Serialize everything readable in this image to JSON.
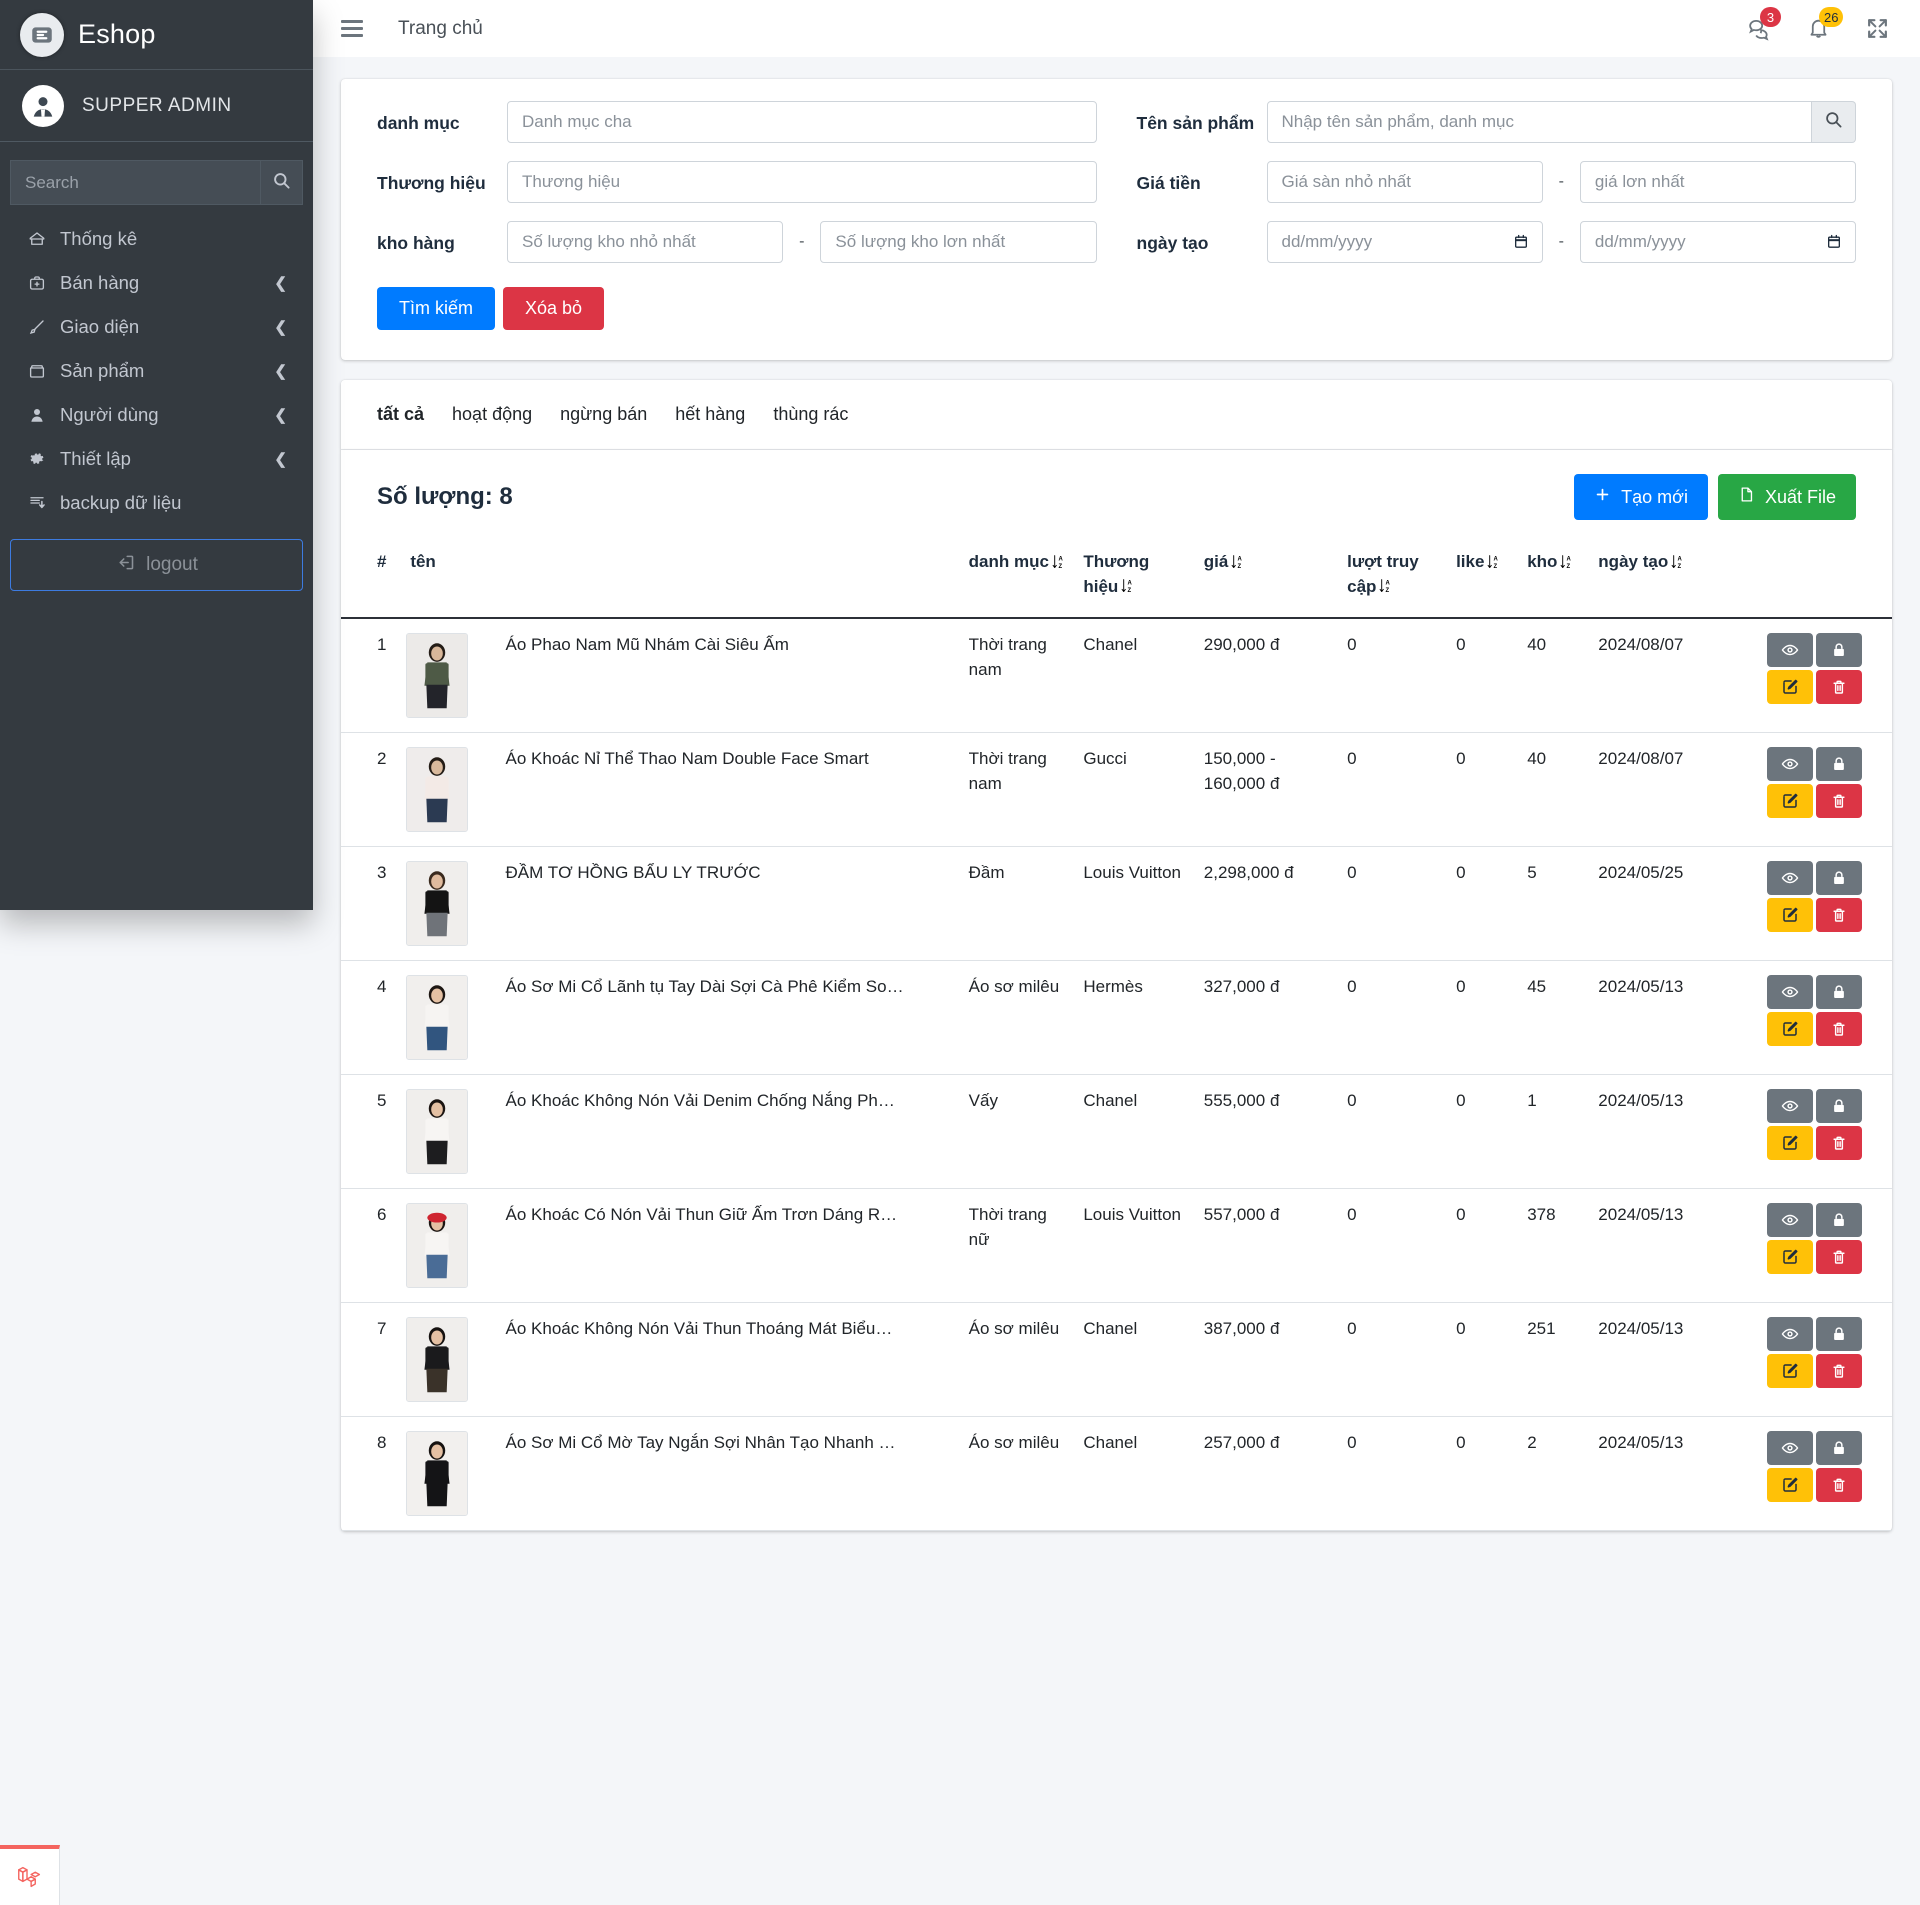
{
  "app": {
    "brand": "Eshop",
    "user": "SUPPER ADMIN",
    "logo_icon": "eshop-logo-icon",
    "avatar_icon": "user-avatar-icon"
  },
  "sidebar": {
    "search_placeholder": "Search",
    "search_button_icon": "search-icon",
    "items": [
      {
        "label": "Thống kê",
        "icon": "home-icon",
        "caret": ""
      },
      {
        "label": "Bán hàng",
        "icon": "briefcase-plus-icon",
        "caret": "❮"
      },
      {
        "label": "Giao diện",
        "icon": "brush-icon",
        "caret": "❮"
      },
      {
        "label": "Sản phẩm",
        "icon": "box-icon",
        "caret": "❮"
      },
      {
        "label": "Người dùng",
        "icon": "user-icon",
        "caret": "❮"
      },
      {
        "label": "Thiết lập",
        "icon": "gear-icon",
        "caret": "❮"
      },
      {
        "label": "backup dữ liệu",
        "icon": "database-download-icon",
        "caret": ""
      }
    ],
    "logout_label": "logout",
    "logout_icon": "logout-icon"
  },
  "header": {
    "menu_icon": "hamburger-icon",
    "home_link": "Trang chủ",
    "chat_icon": "chat-icon",
    "chat_badge": "3",
    "bell_icon": "bell-icon",
    "bell_badge": "26",
    "fullscreen_icon": "fullscreen-expand-icon",
    "badge_red": "#dc3545",
    "badge_yellow": "#ffc107"
  },
  "filters": {
    "category_label": "danh mục",
    "category_placeholder": "Danh mục cha",
    "brand_label": "Thương hiệu",
    "brand_placeholder": "Thương hiệu",
    "stock_label": "kho hàng",
    "stock_min_placeholder": "Số lượng kho nhỏ nhất",
    "stock_max_placeholder": "Số lượng kho lơn nhất",
    "product_name_label": "Tên sản phẩm",
    "product_name_placeholder": "Nhập tên sản phẩm, danh mục",
    "product_search_icon": "search-icon",
    "price_label": "Giá tiền",
    "price_min_placeholder": "Giá sàn nhỏ nhất",
    "price_max_placeholder": "giá lơn nhất",
    "date_label": "ngày tạo",
    "date_from_placeholder": "dd/mm/yyyy",
    "date_to_placeholder": "dd/mm/yyyy",
    "date_icon": "calendar-icon",
    "separator": "-",
    "search_button": "Tìm kiếm",
    "clear_button": "Xóa bỏ",
    "search_button_color": "#007bff",
    "clear_button_color": "#dc3545"
  },
  "tabs": [
    {
      "label": "tất cả",
      "active": true
    },
    {
      "label": "hoạt động",
      "active": false
    },
    {
      "label": "ngừng bán",
      "active": false
    },
    {
      "label": "hết hàng",
      "active": false
    },
    {
      "label": "thùng rác",
      "active": false
    }
  ],
  "toolbar": {
    "count_label": "Số lượng: 8",
    "create_label": "Tạo mới",
    "create_icon": "plus-icon",
    "create_color": "#007bff",
    "export_label": "Xuất File",
    "export_icon": "file-icon",
    "export_color": "#28a745"
  },
  "table": {
    "columns": [
      {
        "label": "#",
        "sortable": false
      },
      {
        "label": "tên",
        "sortable": false
      },
      {
        "label": "danh mục",
        "sortable": true
      },
      {
        "label": "Thương hiệu",
        "sortable": true
      },
      {
        "label": "giá",
        "sortable": true
      },
      {
        "label": "lượt truy cập",
        "sortable": true
      },
      {
        "label": "like",
        "sortable": true
      },
      {
        "label": "kho",
        "sortable": true
      },
      {
        "label": "ngày tạo",
        "sortable": true
      }
    ],
    "sort_icon": "sort-desc-az-icon",
    "row_actions": [
      {
        "name": "view",
        "icon": "eye-icon",
        "color": "#6c757d"
      },
      {
        "name": "lock",
        "icon": "lock-icon",
        "color": "#6c757d"
      },
      {
        "name": "edit",
        "icon": "edit-pencil-icon",
        "color": "#ffc107"
      },
      {
        "name": "delete",
        "icon": "trash-icon",
        "color": "#dc3545"
      }
    ],
    "rows": [
      {
        "index": "1",
        "name": "Áo Phao Nam Mũ Nhám Cài Siêu Ấm",
        "category": "Thời trang nam",
        "brand": "Chanel",
        "price": "290,000 đ",
        "views": "0",
        "likes": "0",
        "stock": "40",
        "created": "2024/08/07",
        "thumb": "green-jacket-man"
      },
      {
        "index": "2",
        "name": "Áo Khoác Nỉ Thể Thao Nam Double Face Smart",
        "category": "Thời trang nam",
        "brand": "Gucci",
        "price": "150,000 - 160,000 đ",
        "views": "0",
        "likes": "0",
        "stock": "40",
        "created": "2024/08/07",
        "thumb": "white-jacket-man"
      },
      {
        "index": "3",
        "name": "ĐẦM TƠ HỒNG BẨU LY TRƯỚC",
        "category": "Đầm",
        "brand": "Louis Vuitton",
        "price": "2,298,000 đ",
        "views": "0",
        "likes": "0",
        "stock": "5",
        "created": "2024/05/25",
        "thumb": "black-top-denim-skirt"
      },
      {
        "index": "4",
        "name": "Áo Sơ Mi Cổ Lãnh tụ Tay Dài Sợi Cà Phê Kiểm So…",
        "category": "Áo sơ milêu",
        "brand": "Hermès",
        "price": "327,000 đ",
        "views": "0",
        "likes": "0",
        "stock": "45",
        "created": "2024/05/13",
        "thumb": "white-tee-jeans"
      },
      {
        "index": "5",
        "name": "Áo Khoác Không Nón Vải Denim Chống Nắng Ph…",
        "category": "Vấy",
        "brand": "Chanel",
        "price": "555,000 đ",
        "views": "0",
        "likes": "0",
        "stock": "1",
        "created": "2024/05/13",
        "thumb": "white-tee-black-skirt"
      },
      {
        "index": "6",
        "name": "Áo Khoác Có Nón Vải Thun Giữ Ấm Trơn Dáng R…",
        "category": "Thời trang nữ",
        "brand": "Louis Vuitton",
        "price": "557,000 đ",
        "views": "0",
        "likes": "0",
        "stock": "378",
        "created": "2024/05/13",
        "thumb": "red-hat-white-tee-jeans"
      },
      {
        "index": "7",
        "name": "Áo Khoác Không Nón Vải Thun Thoáng Mát Biểu…",
        "category": "Áo sơ milêu",
        "brand": "Chanel",
        "price": "387,000 đ",
        "views": "0",
        "likes": "0",
        "stock": "251",
        "created": "2024/05/13",
        "thumb": "black-cardigan-floral-skirt"
      },
      {
        "index": "8",
        "name": "Áo Sơ Mi Cổ Mờ Tay Ngắn Sợi Nhân Tạo Nhanh …",
        "category": "Áo sơ milêu",
        "brand": "Chanel",
        "price": "257,000 đ",
        "views": "0",
        "likes": "0",
        "stock": "2",
        "created": "2024/05/13",
        "thumb": "black-dress"
      }
    ]
  },
  "footer": {
    "mark_icon": "laravel-logo-icon"
  }
}
